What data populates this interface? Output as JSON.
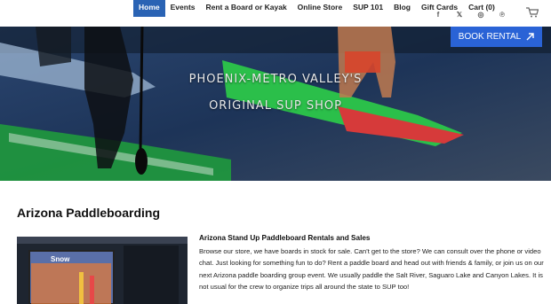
{
  "nav": {
    "links": [
      "Home",
      "Events",
      "Rent a Board or Kayak",
      "Online Store",
      "SUP 101",
      "Blog",
      "Gift Cards",
      "Cart (0)"
    ],
    "social_icons": [
      "facebook-icon",
      "x-icon",
      "instagram-icon",
      "pinterest-icon"
    ],
    "social_glyphs": [
      "f",
      "𝕏",
      "◎",
      "℗"
    ],
    "cart_icon": "shopping-cart-icon",
    "accent": "#2a63b4"
  },
  "hero": {
    "line1": "PHOENIX-METRO VALLEY'S",
    "line2": "ORIGINAL SUP SHOP",
    "book_button": "BOOK RENTAL",
    "book_icon": "arrow-up-right-icon",
    "book_color": "#2a63d6"
  },
  "main": {
    "title": "Arizona Paddleboarding",
    "section_heading": "Arizona Stand Up Paddleboard Rentals and Sales",
    "section_body": "Browse our store, we have boards in stock for sale.  Can't get to the store?  We can consult over the phone or video chat.  Just looking for something fun to do? Rent a paddle board and head out with friends & family, or join us on our next Arizona paddle boarding group event.  We usually paddle the Salt River, Saguaro Lake and Canyon Lakes.  It is not usual for the crew to organize trips all around the state to SUP too!",
    "photo_sign": "Snow"
  }
}
